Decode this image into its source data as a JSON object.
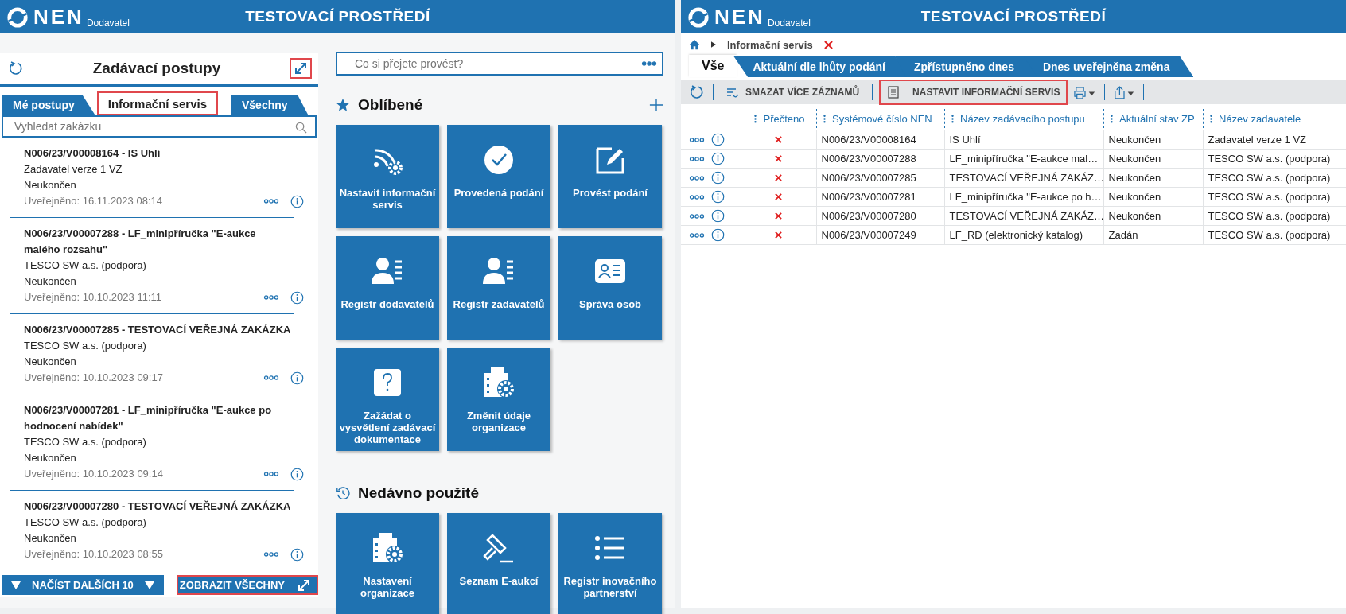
{
  "left_screen": {
    "header": {
      "logo": "NEN",
      "subtitle": "Dodavatel",
      "environment": "TESTOVACÍ PROSTŘEDÍ"
    },
    "procedures_panel": {
      "title": "Zadávací postupy",
      "expand_highlighted": true,
      "tabs": [
        {
          "label": "Mé postupy",
          "selected": false,
          "highlighted": false
        },
        {
          "label": "Informační servis",
          "selected": true,
          "highlighted": true
        },
        {
          "label": "Všechny",
          "selected": false,
          "highlighted": false
        }
      ],
      "search": {
        "placeholder": "Vyhledat zakázku"
      },
      "items": [
        {
          "title": "N006/23/V00008164 - IS Uhlí",
          "authority": "Zadavatel verze 1 VZ",
          "status": "Neukončen",
          "published": "Uveřejněno: 16.11.2023 08:14"
        },
        {
          "title": "N006/23/V00007288 - LF_minipříručka \"E-aukce malého rozsahu\"",
          "authority": "TESCO SW a.s. (podpora)",
          "status": "Neukončen",
          "published": "Uveřejněno: 10.10.2023 11:11"
        },
        {
          "title": "N006/23/V00007285 - TESTOVACÍ VEŘEJNÁ ZAKÁZKA",
          "authority": "TESCO SW a.s. (podpora)",
          "status": "Neukončen",
          "published": "Uveřejněno: 10.10.2023 09:17"
        },
        {
          "title": "N006/23/V00007281 - LF_minipříručka \"E-aukce po hodnocení nabídek\"",
          "authority": "TESCO SW a.s. (podpora)",
          "status": "Neukončen",
          "published": "Uveřejněno: 10.10.2023 09:14"
        },
        {
          "title": "N006/23/V00007280 - TESTOVACÍ VEŘEJNÁ ZAKÁZKA",
          "authority": "TESCO SW a.s. (podpora)",
          "status": "Neukončen",
          "published": "Uveřejněno: 10.10.2023 08:55"
        }
      ],
      "load_more_button": "NAČÍST DALŠÍCH 10",
      "show_all_button": {
        "label": "ZOBRAZIT VŠECHNY",
        "highlighted": true
      }
    },
    "home": {
      "command_search": {
        "placeholder": "Co si přejete provést?"
      },
      "favorites": {
        "title": "Oblíbené",
        "tiles": [
          {
            "label": "Nastavit informační servis",
            "kind": "signal-gear"
          },
          {
            "label": "Provedená podání",
            "kind": "check"
          },
          {
            "label": "Provést podání",
            "kind": "edit"
          },
          {
            "label": "Registr dodavatelů",
            "kind": "person-list"
          },
          {
            "label": "Registr zadavatelů",
            "kind": "person-list"
          },
          {
            "label": "Správa osob",
            "kind": "id-card"
          },
          {
            "label": "Zažádat o vysvětlení zadávací dokumentace",
            "kind": "question"
          },
          {
            "label": "Změnit údaje organizace",
            "kind": "building-gear"
          }
        ]
      },
      "recent": {
        "title": "Nedávno použité",
        "tiles": [
          {
            "label": "Nastavení organizace",
            "kind": "building-gear"
          },
          {
            "label": "Seznam E-aukcí",
            "kind": "gavel"
          },
          {
            "label": "Registr inovačního partnerství",
            "kind": "list"
          }
        ]
      }
    }
  },
  "right_screen": {
    "header": {
      "logo": "NEN",
      "subtitle": "Dodavatel",
      "environment": "TESTOVACÍ PROSTŘEDÍ"
    },
    "breadcrumb": {
      "current": "Informační servis"
    },
    "tabs": [
      {
        "label": "Vše",
        "selected": true
      },
      {
        "label": "Aktuální dle lhůty podání",
        "selected": false
      },
      {
        "label": "Zpřístupněno dnes",
        "selected": false
      },
      {
        "label": "Dnes uveřejněna změna",
        "selected": false
      }
    ],
    "toolbar": {
      "delete_button": "SMAZAT VÍCE ZÁZNAMŮ",
      "settings_button": {
        "label": "NASTAVIT INFORMAČNÍ SERVIS",
        "highlighted": true
      }
    },
    "table": {
      "columns": [
        "Přečteno",
        "Systémové číslo NEN",
        "Název zadávacího postupu",
        "Aktuální stav ZP",
        "Název zadavatele"
      ],
      "rows": [
        {
          "read": false,
          "number": "N006/23/V00008164",
          "name": "IS Uhlí",
          "status": "Neukončen",
          "authority": "Zadavatel verze 1 VZ"
        },
        {
          "read": false,
          "number": "N006/23/V00007288",
          "name": "LF_minipříručka \"E-aukce mal…",
          "status": "Neukončen",
          "authority": "TESCO SW a.s. (podpora)"
        },
        {
          "read": false,
          "number": "N006/23/V00007285",
          "name": "TESTOVACÍ VEŘEJNÁ ZAKÁZ…",
          "status": "Neukončen",
          "authority": "TESCO SW a.s. (podpora)"
        },
        {
          "read": false,
          "number": "N006/23/V00007281",
          "name": "LF_minipříručka \"E-aukce po h…",
          "status": "Neukončen",
          "authority": "TESCO SW a.s. (podpora)"
        },
        {
          "read": false,
          "number": "N006/23/V00007280",
          "name": "TESTOVACÍ VEŘEJNÁ ZAKÁZ…",
          "status": "Neukončen",
          "authority": "TESCO SW a.s. (podpora)"
        },
        {
          "read": false,
          "number": "N006/23/V00007249",
          "name": "LF_RD (elektronický katalog)",
          "status": "Zadán",
          "authority": "TESCO SW a.s. (podpora)"
        }
      ]
    }
  }
}
